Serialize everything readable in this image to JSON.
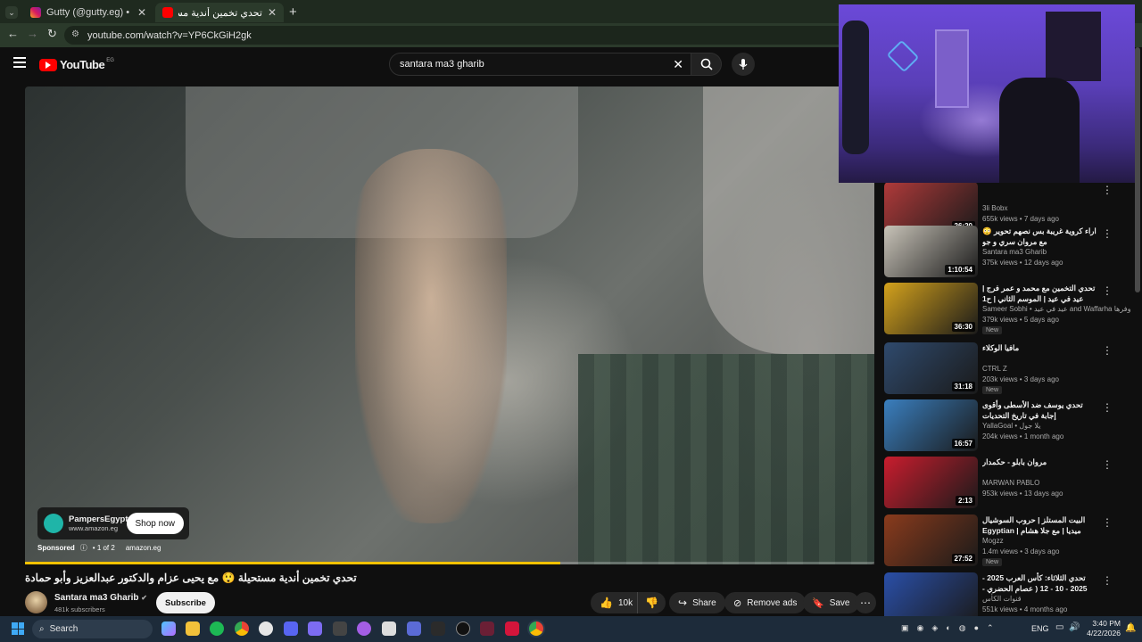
{
  "browser": {
    "tabs": [
      {
        "label": "Gutty (@gutty.eg) • Instagram",
        "active": false
      },
      {
        "label": "تحدي تخمين أندية مستحيلة 😲 مع",
        "active": true
      }
    ],
    "url": "youtube.com/watch?v=YP6CkGiH2gk"
  },
  "yt": {
    "logo_text": "YouTube",
    "region": "EG",
    "search_value": "santara ma3 gharib"
  },
  "ad": {
    "brand": "PampersEgypt",
    "domain": "www.amazon.eg",
    "cta": "Shop now",
    "sponsored": "Sponsored",
    "count": "1 of 2",
    "site": "amazon.eg",
    "progress": 0.63
  },
  "video": {
    "title": "تحدي تخمين أندية مستحيلة 😲 مع يحيى عزام والدكتور عبدالعزيز وأبو حمادة",
    "channel": "Santara ma3 Gharib",
    "subscribers": "481k subscribers",
    "subscribe": "Subscribe",
    "likes": "10k",
    "share": "Share",
    "remove_ads": "Remove ads",
    "save": "Save"
  },
  "recommendations": [
    {
      "title": "",
      "channel": "3li Bobx",
      "meta": "655k views • 7 days ago",
      "duration": "26:20",
      "new": "",
      "color": "#b03a3a"
    },
    {
      "title": "اراء كروية غريبة بس نصهم تحوير 😳 مع مروان سري و جو",
      "channel": "Santara ma3 Gharib",
      "meta": "375k views • 12 days ago",
      "duration": "1:10:54",
      "new": "",
      "color": "#c8c3b8"
    },
    {
      "title": "تحدي التخمين مع محمد و عمر فرج | عيد في عيد | الموسم الثاني | ح1",
      "channel": "Sameer Sobhi • عيد في عيد and Waffarha وفرها",
      "meta": "379k views • 5 days ago",
      "duration": "36:30",
      "new": "New",
      "color": "#d4a21c"
    },
    {
      "title": "مافيا الوكلاء",
      "channel": "CTRL Z",
      "meta": "203k views • 3 days ago",
      "duration": "31:18",
      "new": "New",
      "color": "#2f4a6d"
    },
    {
      "title": "تحدي يوسف ضد الأسطى وأقوى إجابة في تاريخ التحديات",
      "channel": "YallaGoal • يلا جول",
      "meta": "204k views • 1 month ago",
      "duration": "16:57",
      "new": "",
      "color": "#3a7fbf"
    },
    {
      "title": "مروان بابلو - حكمدار",
      "channel": "MARWAN PABLO",
      "meta": "953k views • 13 days ago",
      "duration": "2:13",
      "new": "",
      "color": "#c91d2e"
    },
    {
      "title": "البيت المستلز | حروب السوشيال ميديا | مع جلا هشام | Egyptian Drama",
      "channel": "Mogzz",
      "meta": "1.4m views • 3 days ago",
      "duration": "27:52",
      "new": "New",
      "color": "#8a3b1c"
    },
    {
      "title": "تحدي الثلاثاء: كأس العرب 2025 - 2025 - 10 - 12 ( عصام الحضري - محمد",
      "channel": "قنوات الكأس",
      "meta": "551k views • 4 months ago",
      "duration": "",
      "new": "",
      "color": "#2a4fa8"
    }
  ],
  "taskbar": {
    "search_label": "Search",
    "lang": "ENG",
    "time": "3:40 PM",
    "date": "4/22/2026"
  }
}
